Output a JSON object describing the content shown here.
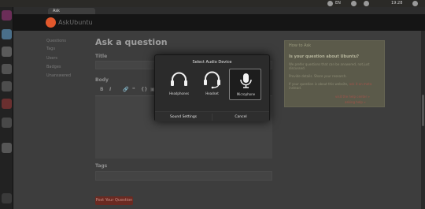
{
  "top_panel": {
    "left_text": "",
    "indicators": [
      "network-icon",
      "sound-icon",
      "mail-icon",
      "power-icon"
    ],
    "right_text": "EN",
    "clock_text": "19:28"
  },
  "browser": {
    "tab_label": "Ask"
  },
  "site": {
    "logo_text": "AskUbuntu",
    "nav": [
      "Questions",
      "Tags",
      "Users",
      "Badges",
      "Unanswered"
    ]
  },
  "page": {
    "heading": "Ask a question",
    "title_label": "Title",
    "body_label": "Body",
    "tags_label": "Tags",
    "toolbar": [
      "B",
      "I",
      "🔗",
      "❝",
      "{}",
      "▣"
    ],
    "submit_label": "Post Your Question"
  },
  "help": {
    "title": "How to Ask",
    "question": "Is your question about Ubuntu?",
    "para1": "We prefer questions that can be answered, not just discussed.",
    "para2": "Provide details. Share your research.",
    "para3_prefix": "If your question is about this website,",
    "para3_link": "ask it on meta",
    "para3_suffix": "instead.",
    "link1": "visit the help center »",
    "link2": "asking help »"
  },
  "dialog": {
    "title": "Select Audio Device",
    "options": [
      {
        "label": "Headphones",
        "icon": "headphones-icon",
        "selected": false
      },
      {
        "label": "Headset",
        "icon": "headset-icon",
        "selected": false
      },
      {
        "label": "Microphone",
        "icon": "microphone-icon",
        "selected": true
      }
    ],
    "sound_settings_label": "Sound Settings",
    "cancel_label": "Cancel"
  },
  "colors": {
    "ubuntu_orange": "#e2582c",
    "dialog_bg": "#2b2b2b",
    "launcher_bg": "#222222"
  }
}
